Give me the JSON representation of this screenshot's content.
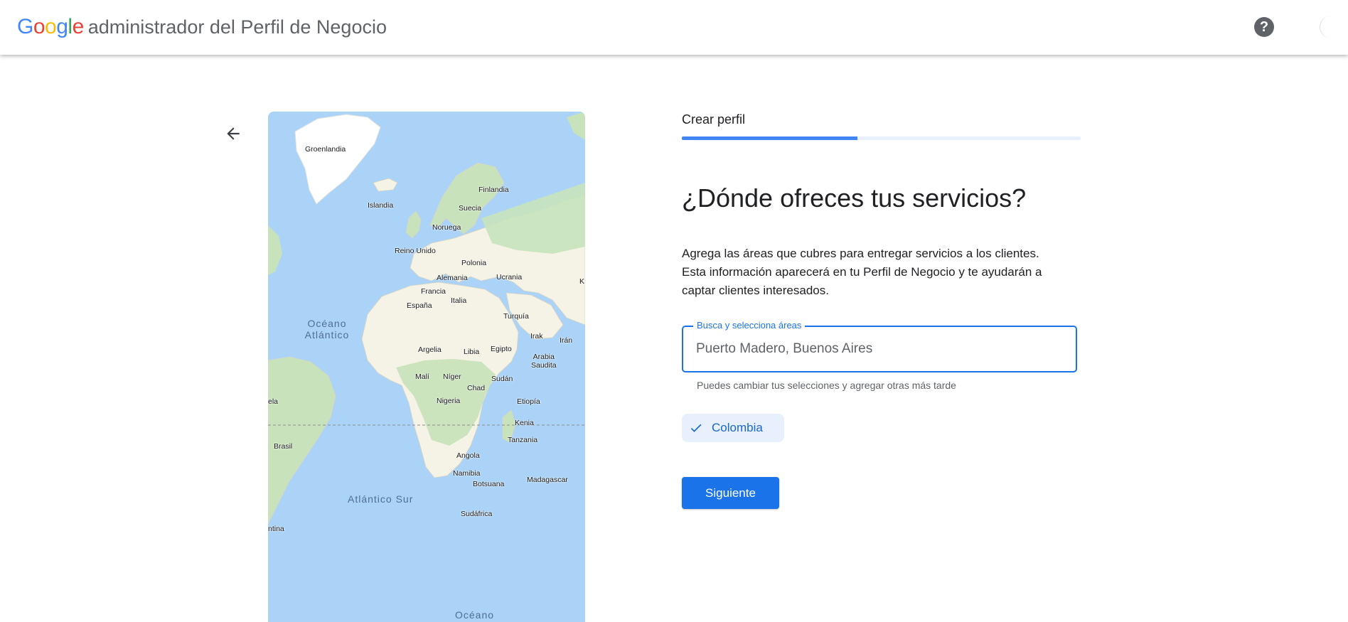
{
  "header": {
    "logo": {
      "letters": [
        "G",
        "o",
        "o",
        "g",
        "l",
        "e"
      ]
    },
    "product_name": "administrador del Perfil de Negocio",
    "help_symbol": "?",
    "help_icon": "help-circle-icon",
    "account_icon": "account-avatar"
  },
  "navigation": {
    "back_icon": "arrow-left-icon"
  },
  "map": {
    "labels": {
      "greenland": "Groenlandia",
      "iceland": "Islandia",
      "finland": "Finlandia",
      "sweden": "Suecia",
      "norway": "Noruega",
      "uk": "Reino Unido",
      "poland": "Polonia",
      "germany": "Alemania",
      "ukraine": "Ucrania",
      "france": "Francia",
      "italy": "Italia",
      "spain": "España",
      "turkey": "Turquía",
      "atlantic_1": "Océano",
      "atlantic_2": "Atlántico",
      "iraq": "Irak",
      "iran": "Irán",
      "algeria": "Argelia",
      "libya": "Libia",
      "egypt": "Egipto",
      "saudi_1": "Arabia",
      "saudi_2": "Saudita",
      "mali": "Malí",
      "niger": "Níger",
      "sudan": "Sudán",
      "chad": "Chad",
      "nigeria": "Nigeria",
      "ethiopia": "Etiopía",
      "kenya": "Kenia",
      "tanzania": "Tanzania",
      "brazil": "Brasil",
      "angola": "Angola",
      "namibia": "Namibia",
      "botswana": "Botsuana",
      "madagascar": "Madagascar",
      "south_atlantic": "Atlántico Sur",
      "south_africa": "Sudáfrica",
      "argentina_partial": "ntina",
      "bottom_ocean": "Océano",
      "edge_left": "ela",
      "edge_right": "K"
    }
  },
  "form": {
    "step_label": "Crear perfil",
    "progress": 0.44,
    "question": "¿Dónde ofreces tus servicios?",
    "description_lines": [
      "Agrega las áreas que cubres para entregar servicios a los clientes.",
      "Esta información aparecerá en tu Perfil de Negocio y te ayudarán a",
      "captar clientes interesados."
    ],
    "search": {
      "label": "Busca y selecciona áreas",
      "value": "Puerto Madero, Buenos Aires"
    },
    "helper_text": "Puedes cambiar tus selecciones y agregar otras más tarde",
    "chip": {
      "label": "Colombia",
      "icon": "check-icon"
    },
    "next_label": "Siguiente"
  },
  "colors": {
    "primary": "#1a73e8",
    "progress_track": "#e8f0fe",
    "chip_bg": "#e8f0fe",
    "ocean": "#aad3f7",
    "land": "#f5f3e6",
    "vegetation": "#c8e3bc",
    "ice": "#ffffff"
  }
}
